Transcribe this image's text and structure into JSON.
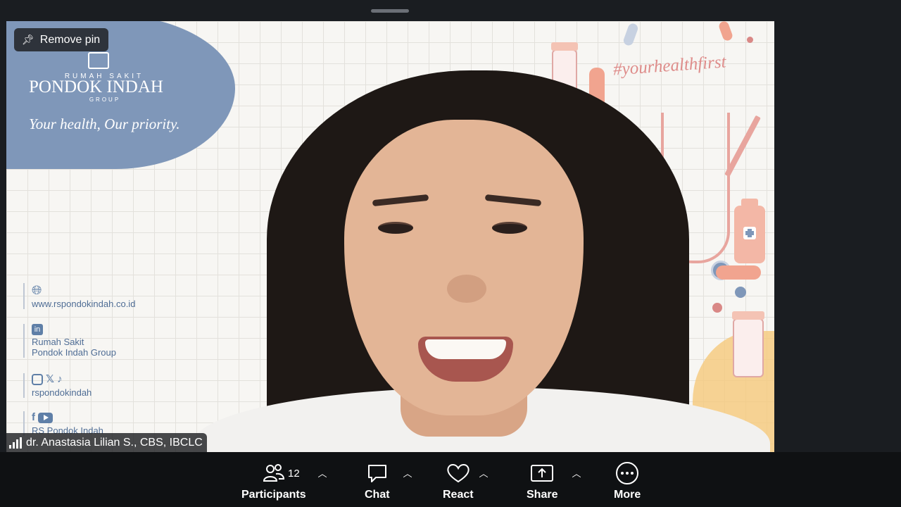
{
  "window": {
    "pin_button_label": "Remove pin"
  },
  "background": {
    "brand_small": "RUMAH SAKIT",
    "brand_name": "PONDOK INDAH",
    "brand_group": "GROUP",
    "tagline": "Your health,  Our priority.",
    "hashtag": "#yourhealthfirst",
    "website": "www.rspondokindah.co.id",
    "linkedin_line1": "Rumah Sakit",
    "linkedin_line2": "Pondok Indah Group",
    "social_handle": "rspondokindah",
    "facebook_youtube": "RS Pondok Indah"
  },
  "participant": {
    "name": "dr. Anastasia Lilian S., CBS, IBCLC"
  },
  "toolbar": {
    "participants_label": "Participants",
    "participants_count": "12",
    "chat_label": "Chat",
    "react_label": "React",
    "share_label": "Share",
    "more_label": "More"
  }
}
